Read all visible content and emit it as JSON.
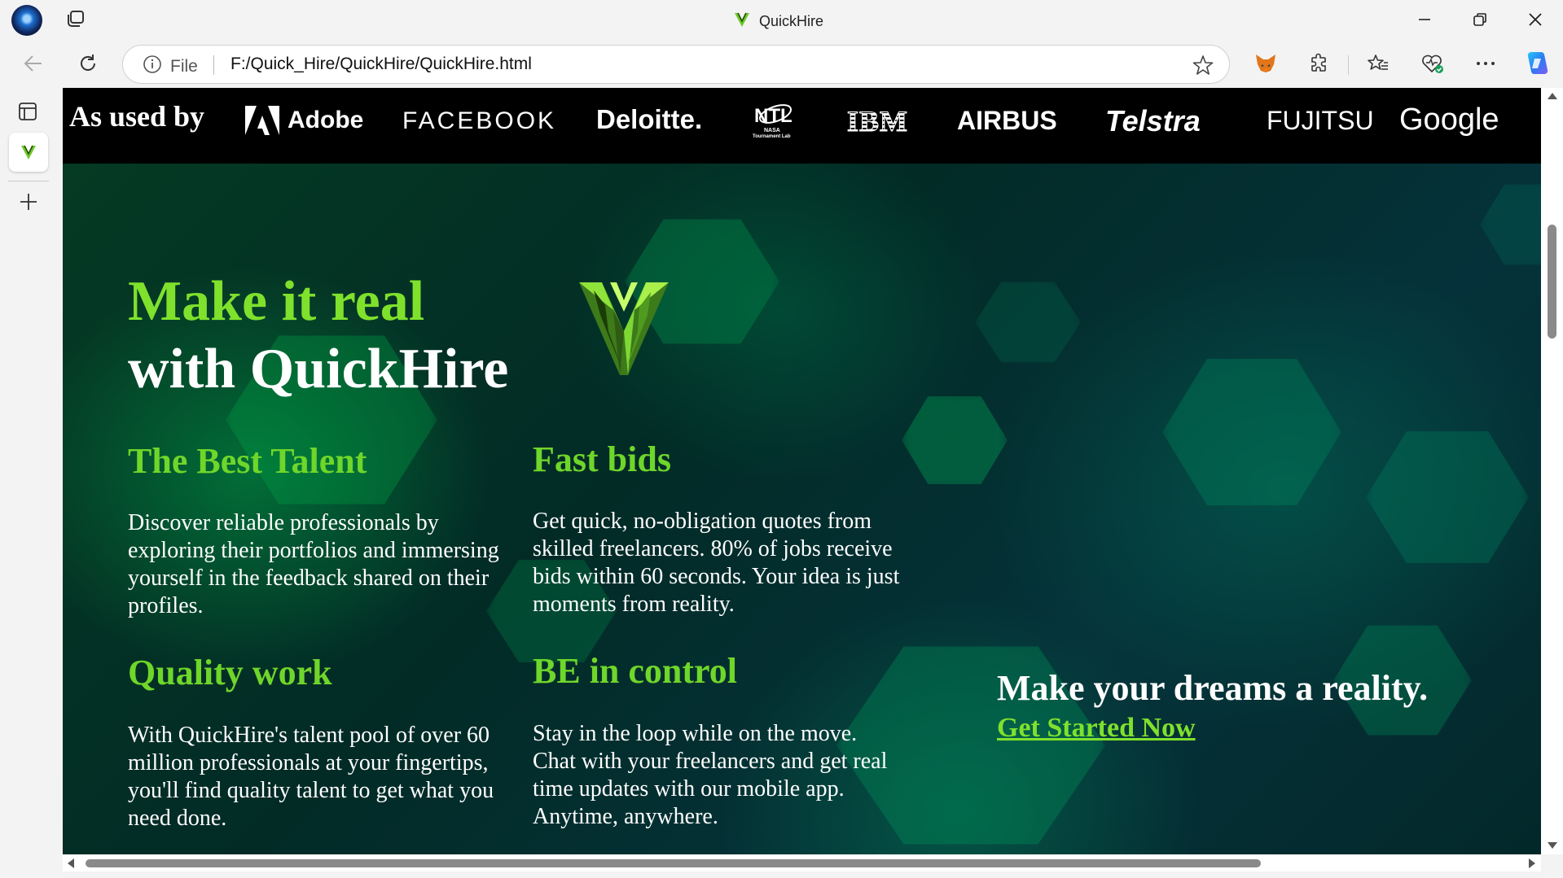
{
  "browser": {
    "tab_title": "QuickHire",
    "address": {
      "info_label": "File",
      "url": "F:/Quick_Hire/QuickHire/QuickHire.html"
    }
  },
  "page": {
    "as_used_by": "As used by",
    "brands": [
      "Adobe",
      "FACEBOOK",
      "Deloitte.",
      "NASA Tournament Lab",
      "IBM",
      "AIRBUS",
      "Telstra",
      "FUJITSU",
      "Google"
    ],
    "hero": {
      "title_line1": "Make it real",
      "title_line2": "with QuickHire"
    },
    "features": [
      {
        "title": "The Best Talent",
        "text": "Discover reliable professionals by exploring their portfolios and immersing yourself in the feedback shared on their profiles."
      },
      {
        "title": "Fast bids",
        "text": "Get quick, no-obligation quotes from skilled freelancers. 80% of jobs receive bids within 60 seconds. Your idea is just moments from reality."
      },
      {
        "title": "Quality work",
        "text": "With QuickHire's talent pool of over 60 million professionals at your fingertips, you'll find quality talent to get what you need done."
      },
      {
        "title": "BE in control",
        "text": "Stay in the loop while on the move. Chat with your freelancers and get real time updates with our mobile app. Anytime, anywhere."
      }
    ],
    "cta": {
      "headline": "Make your dreams a reality.",
      "link": "Get Started Now"
    }
  },
  "colors": {
    "accent_green": "#7fe12c",
    "hero_bg": "#02221f"
  }
}
